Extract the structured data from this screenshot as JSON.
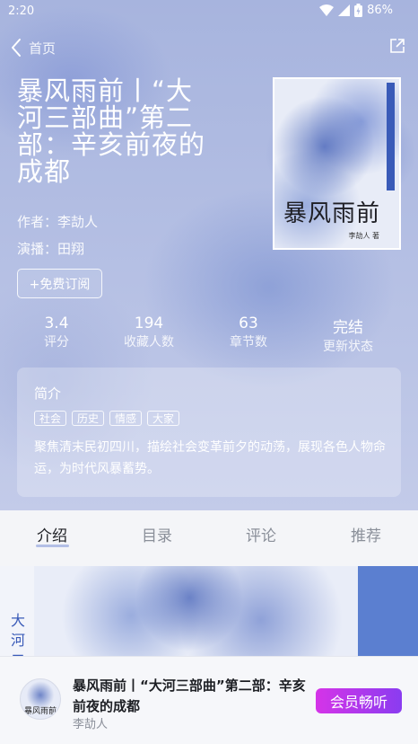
{
  "status": {
    "time": "2:20",
    "battery": "86%"
  },
  "nav": {
    "back_label": "首页"
  },
  "book": {
    "title": "暴风雨前丨“大河三部曲”第二部：辛亥前夜的成都",
    "author_line": "作者：李劼人",
    "narrator_line": "演播：田翔",
    "subscribe_label": "+免费订阅",
    "cover_title": "暴风雨前",
    "cover_author": "李劼人 著"
  },
  "stats": [
    {
      "value": "3.4",
      "label": "评分"
    },
    {
      "value": "194",
      "label": "收藏人数"
    },
    {
      "value": "63",
      "label": "章节数"
    },
    {
      "value": "完结",
      "label": "更新状态"
    }
  ],
  "intro": {
    "heading": "简介",
    "tags": [
      "社会",
      "历史",
      "情感",
      "大家"
    ],
    "text": "聚焦清末民初四川，描绘社会变革前夕的动荡，展现各色人物命运，为时代风暴蓄势。"
  },
  "tabs": [
    {
      "label": "介绍",
      "active": true
    },
    {
      "label": "目录",
      "active": false
    },
    {
      "label": "评论",
      "active": false
    },
    {
      "label": "推荐",
      "active": false
    }
  ],
  "poster": {
    "side_text": "大河二"
  },
  "player": {
    "title": "暴风雨前丨“大河三部曲”第二部：辛亥前夜的成都",
    "author": "李劼人",
    "thumb_text": "暴风雨前",
    "vip_label": "会员畅听"
  },
  "colors": {
    "accent": "#3a5bb8",
    "vip_start": "#d534e8",
    "vip_end": "#8a3cf0"
  },
  "icons": [
    "wifi-icon",
    "signal-icon",
    "battery-icon",
    "back-chevron-icon",
    "share-icon"
  ]
}
